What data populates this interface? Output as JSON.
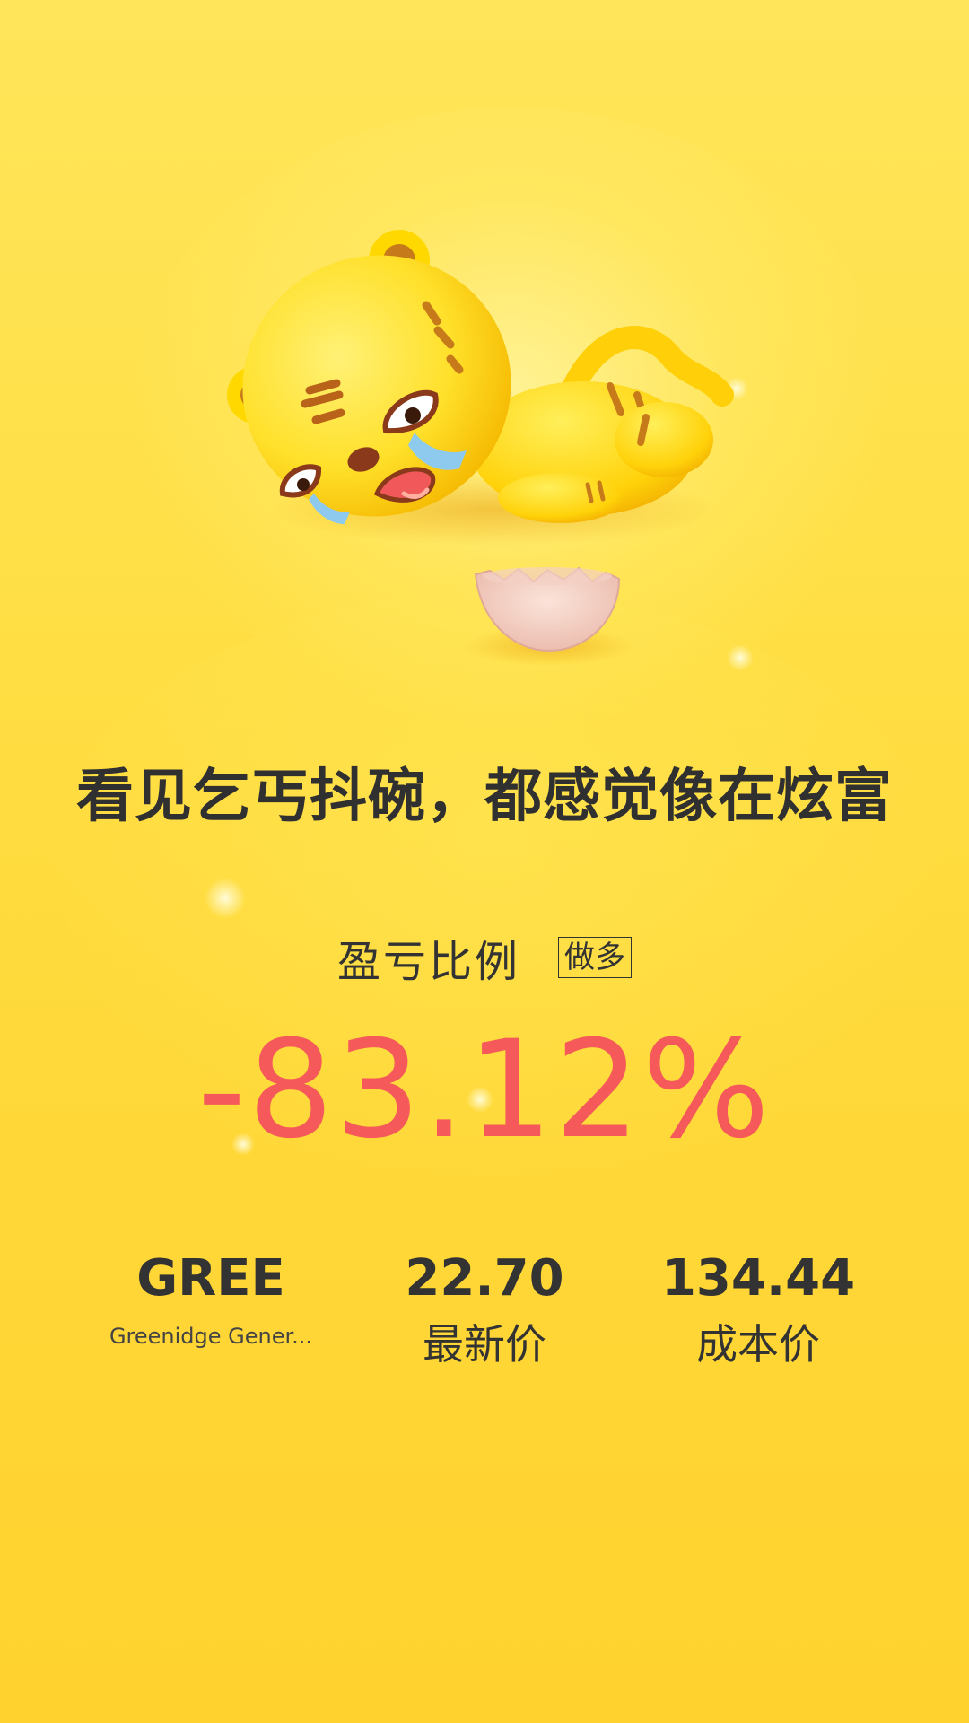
{
  "headline": "看见乞丐抖碗，都感觉像在炫富",
  "ratio": {
    "label": "盈亏比例",
    "direction": "做多",
    "value": "-83.12%"
  },
  "stock": {
    "ticker": "GREE",
    "name": "Greenidge Gener..."
  },
  "latest_price": {
    "value": "22.70",
    "label": "最新价"
  },
  "cost_price": {
    "value": "134.44",
    "label": "成本价"
  },
  "illustration": {
    "icon": "crying-tiger-mascot-with-broken-bowl"
  },
  "colors": {
    "background": "#ffdf45",
    "loss": "#f5595a",
    "text": "#333333"
  }
}
